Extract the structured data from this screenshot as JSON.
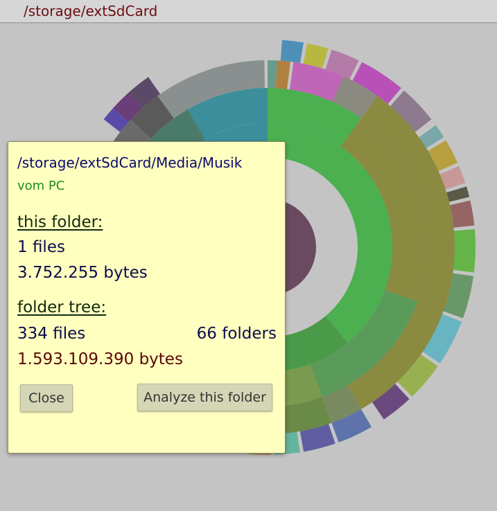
{
  "header": {
    "path": "/storage/extSdCard"
  },
  "dialog": {
    "path": "/storage/extSdCard/Media/Musik",
    "subtitle": "vom PC",
    "this_folder_heading": "this folder:",
    "this_folder_files": "1 files",
    "this_folder_bytes": "3.752.255 bytes",
    "folder_tree_heading": "folder tree:",
    "tree_files": "334 files",
    "tree_folders": "66 folders",
    "tree_bytes": "1.593.109.390 bytes",
    "close_label": "Close",
    "analyze_label": "Analyze this folder"
  },
  "colors": {
    "background": "#c4c4c4",
    "dialog_bg": "#ffffc0",
    "header_path": "#6e0d12"
  }
}
